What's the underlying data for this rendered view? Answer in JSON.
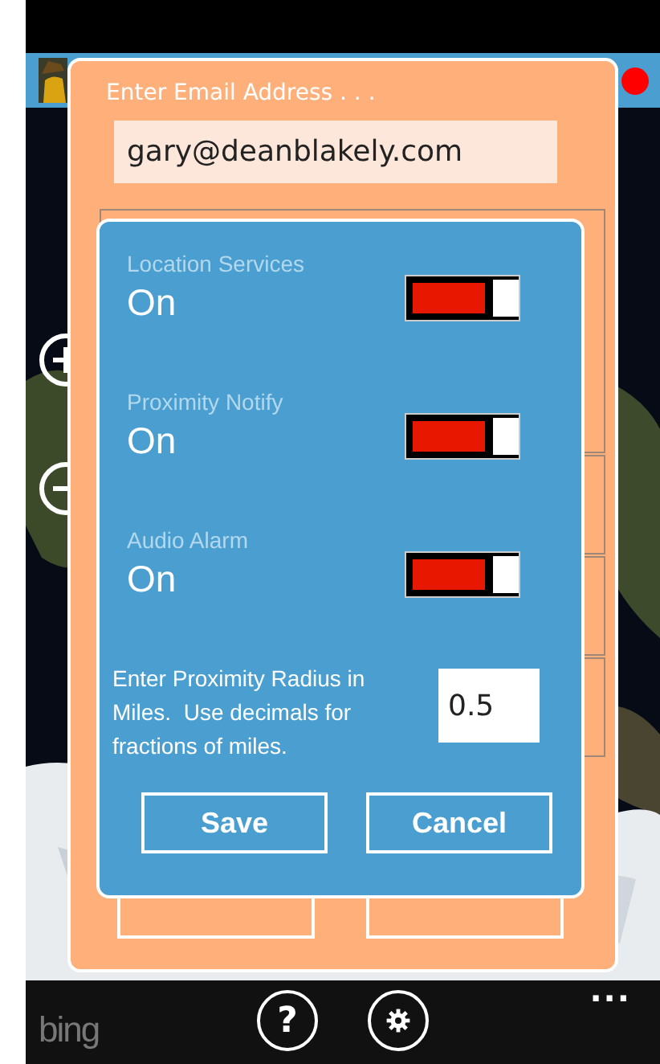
{
  "email_dialog": {
    "title": "Enter Email Address . . .",
    "email": "gary@deanblakely.com"
  },
  "settings_dialog": {
    "toggles": [
      {
        "label": "Location Services",
        "state_text": "On",
        "on": true
      },
      {
        "label": "Proximity Notify",
        "state_text": "On",
        "on": true
      },
      {
        "label": "Audio Alarm",
        "state_text": "On",
        "on": true
      }
    ],
    "radius": {
      "prompt": "Enter Proximity Radius in Miles.  Use decimals for fractions of miles.",
      "value": "0.5"
    },
    "buttons": [
      "Save",
      "Cancel"
    ]
  },
  "app_bar": {
    "logo": "bing",
    "help": "?",
    "more": "..."
  }
}
